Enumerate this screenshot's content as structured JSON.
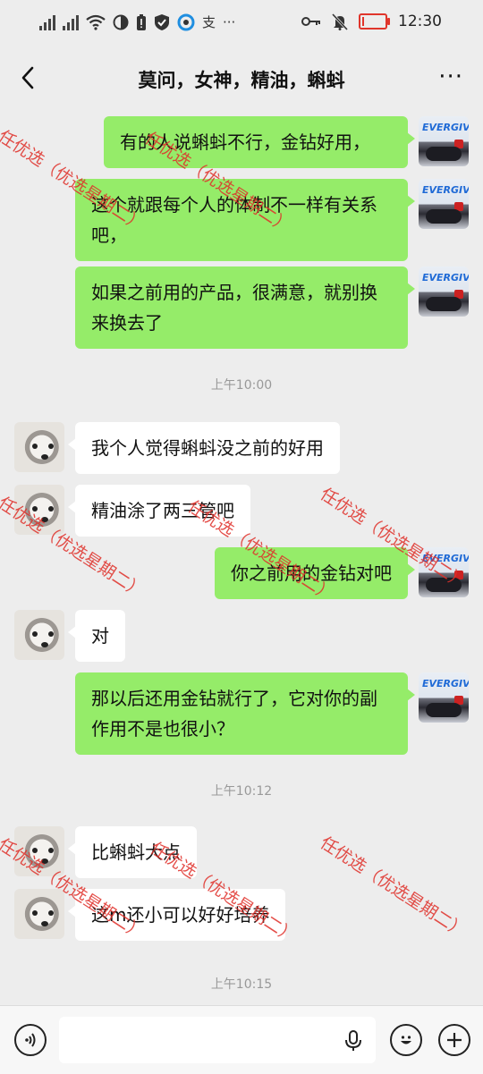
{
  "status_bar": {
    "left_icons": [
      "signal-icon",
      "signal-icon",
      "wifi-icon",
      "half-circle-icon",
      "battery-alert-icon",
      "shield-check-icon",
      "app-icon",
      "alipay-icon",
      "more-dots-icon"
    ],
    "right_icons": [
      "key-icon",
      "mute-bell-icon",
      "battery-low-icon"
    ],
    "alipay_char": "支",
    "more": "···",
    "time": "12:30",
    "battery_level": 0.08,
    "battery_color": "#e0352b"
  },
  "nav": {
    "title": "莫问，女神，精油，蝌蚪",
    "more": "···"
  },
  "messages": [
    {
      "side": "me",
      "text": "有的人说蝌蚪不行，金钻好用，"
    },
    {
      "side": "me",
      "text": "这个就跟每个人的体制不一样有关系吧，"
    },
    {
      "side": "me",
      "text": "如果之前用的产品，很满意，就别换来换去了"
    },
    {
      "type": "time",
      "text": "上午10:00"
    },
    {
      "side": "other",
      "text": "我个人觉得蝌蚪没之前的好用"
    },
    {
      "side": "other",
      "text": "精油涂了两三管吧"
    },
    {
      "side": "me",
      "text": "你之前用的金钻对吧"
    },
    {
      "side": "other",
      "text": "对"
    },
    {
      "side": "me",
      "text": "那以后还用金钻就行了，它对你的副作用不是也很小？"
    },
    {
      "type": "time",
      "text": "上午10:12"
    },
    {
      "side": "other",
      "text": "比蝌蚪大点"
    },
    {
      "side": "other",
      "text": "这m还小可以好好培养"
    },
    {
      "type": "time",
      "text": "上午10:15"
    }
  ],
  "avatars": {
    "me_text": "EVERGIVE"
  },
  "watermark": {
    "text": "任优选（优选星期二）",
    "color": "#e0302a"
  },
  "input_bar": {
    "placeholder": ""
  },
  "colors": {
    "bg": "#ededed",
    "bubble_me": "#95ec69",
    "bubble_other": "#ffffff",
    "timestamp": "#999999"
  }
}
